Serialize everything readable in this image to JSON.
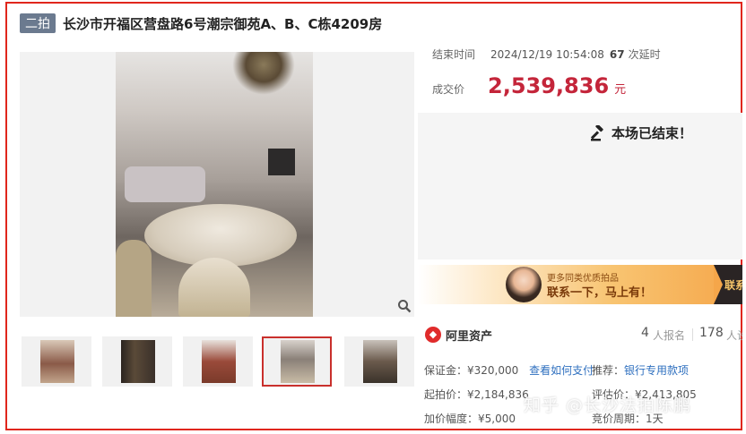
{
  "header": {
    "round_badge": "二拍",
    "title": "长沙市开福区营盘路6号潮宗御苑A、B、C栋4209房"
  },
  "gallery": {
    "thumb_count": 5,
    "active_index": 3
  },
  "auction": {
    "end_time_label": "结束时间",
    "end_time": "2024/12/19 10:54:08",
    "delay_count": "67",
    "delay_label": "次延时",
    "price_label": "成交价",
    "price": "2,539,836",
    "price_unit": "元",
    "ended_message": "本场已结束！"
  },
  "banner": {
    "subtitle": "更多同类优质拍品",
    "main_text": "联系一下，马上有！",
    "cut_text": "联系"
  },
  "platform": {
    "logo_name": "阿里资产",
    "registered_count": "4",
    "registered_label": "人报名",
    "watch_count": "178",
    "watch_label": "人设"
  },
  "details": {
    "deposit_label": "保证金：",
    "deposit_value": "¥320,000",
    "deposit_link": "查看如何支付",
    "recommend_label": "推荐：",
    "recommend_link": "银行专用款项",
    "start_price_label": "起拍价：",
    "start_price_value": "¥2,184,836",
    "appraisal_label": "评估价：",
    "appraisal_value": "¥2,413,805",
    "increment_label": "加价幅度：",
    "increment_value": "¥5,000",
    "cycle_label": "竞价周期：",
    "cycle_value": "1天"
  },
  "watermark": "知乎 @长沙法拍陈鹏"
}
